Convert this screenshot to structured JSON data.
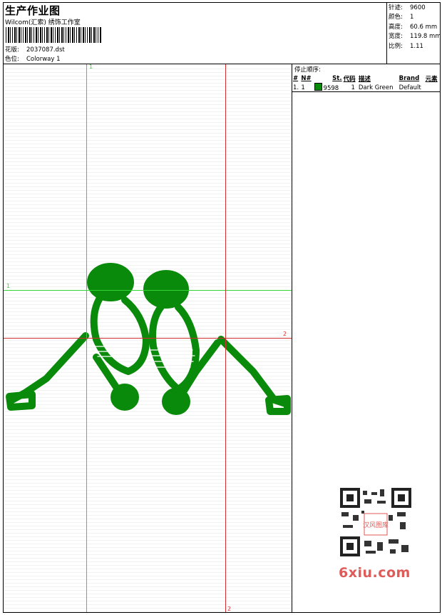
{
  "header": {
    "title": "生产作业图",
    "subtitle": "Wilcom(汇索) 绣饰工作室",
    "design_label": "花版:",
    "design_value": "2037087.dst",
    "colorway_label": "色位:",
    "colorway_value": "Colorway 1"
  },
  "stats": {
    "stitches_label": "针迹:",
    "stitches_value": "9600",
    "colors_label": "颜色:",
    "colors_value": "1",
    "height_label": "高度:",
    "height_value": "60.6 mm",
    "width_label": "宽度:",
    "width_value": "119.8 mm",
    "scale_label": "比例:",
    "scale_value": "1.11"
  },
  "stop_sequence": {
    "title": "停止顺序:",
    "columns": [
      "#",
      "N#",
      "St.",
      "代码",
      "描述",
      "Brand",
      "元素"
    ],
    "rows": [
      {
        "index": "1.",
        "needle": "1",
        "color": "#0a8a0a",
        "stitch_code": "9598",
        "code": "1",
        "description": "Dark Green",
        "brand": "Default",
        "element": ""
      }
    ]
  },
  "guides": {
    "green_v_label": "1",
    "green_h_label": "1",
    "red_h_label": "2",
    "red_v_label": "2",
    "green_color": "#35d435",
    "red_color": "#d03030"
  },
  "watermark": {
    "logo_text": "6xiu.com",
    "seal_text": "汉风图库"
  },
  "colors": {
    "embroidery": "#0a8a0a"
  }
}
